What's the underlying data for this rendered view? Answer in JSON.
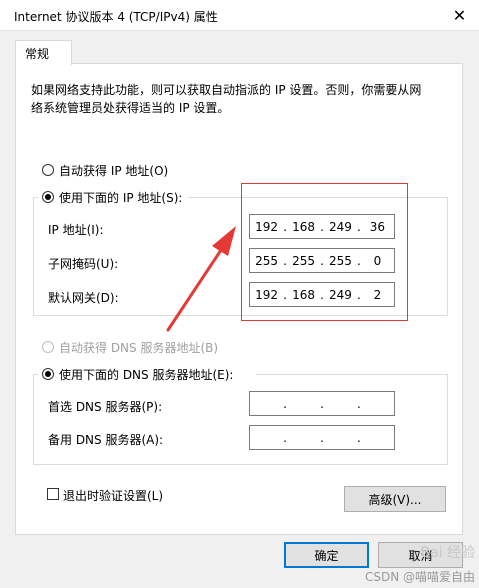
{
  "window": {
    "title": "Internet 协议版本 4 (TCP/IPv4) 属性",
    "close_glyph": "✕"
  },
  "tabs": [
    {
      "label": "常规"
    }
  ],
  "description": "如果网络支持此功能，则可以获取自动指派的 IP 设置。否则，你需要从网\n络系统管理员处获得适当的 IP 设置。",
  "ip_section": {
    "auto_label": "自动获得 IP 地址(O)",
    "manual_label": "使用下面的 IP 地址(S):",
    "selected": "manual",
    "fields": [
      {
        "label": "IP 地址(I):",
        "octets": [
          "192",
          "168",
          "249",
          "36"
        ]
      },
      {
        "label": "子网掩码(U):",
        "octets": [
          "255",
          "255",
          "255",
          "0"
        ]
      },
      {
        "label": "默认网关(D):",
        "octets": [
          "192",
          "168",
          "249",
          "2"
        ]
      }
    ]
  },
  "dns_section": {
    "auto_label": "自动获得 DNS 服务器地址(B)",
    "manual_label": "使用下面的 DNS 服务器地址(E):",
    "selected": "manual",
    "fields": [
      {
        "label": "首选 DNS 服务器(P):",
        "octets": [
          "",
          "",
          "",
          ""
        ]
      },
      {
        "label": "备用 DNS 服务器(A):",
        "octets": [
          "",
          "",
          "",
          ""
        ]
      }
    ]
  },
  "validate_label": "退出时验证设置(L)",
  "advanced_label": "高级(V)...",
  "ok_label": "确定",
  "cancel_label": "取消",
  "watermark": {
    "line1": "Bai 经验",
    "line2": "CSDN @喵喵爱自由"
  },
  "colors": {
    "annotation_red": "#e53935",
    "primary_border": "#0078d7"
  }
}
